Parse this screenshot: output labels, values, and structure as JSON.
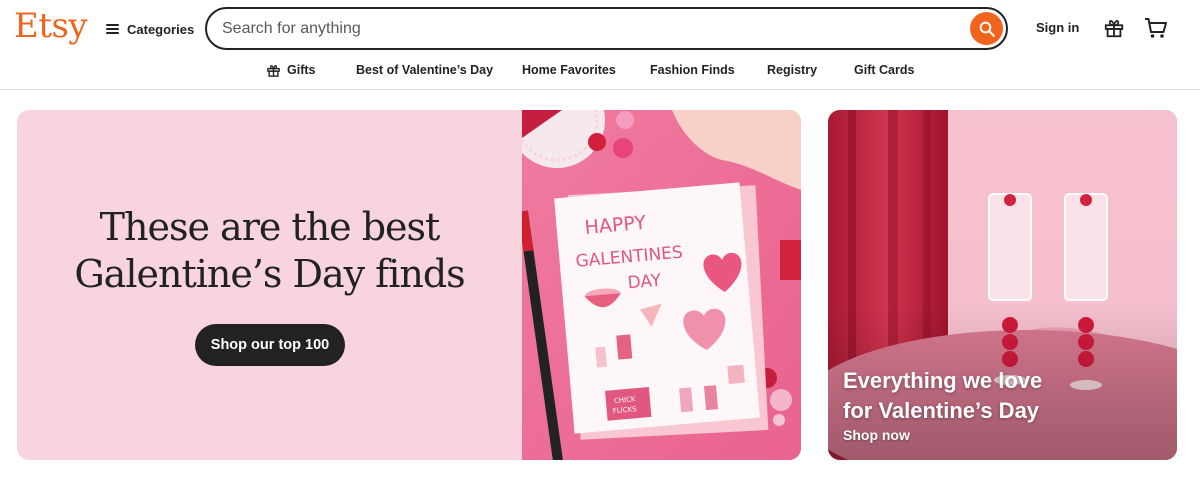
{
  "header": {
    "logo": "Etsy",
    "categories_label": "Categories",
    "search": {
      "placeholder": "Search for anything",
      "value": ""
    },
    "sign_in": "Sign in",
    "icons": {
      "search": "search-icon",
      "gift": "gift-icon",
      "cart": "cart-icon",
      "menu": "hamburger-icon"
    }
  },
  "nav": {
    "items": [
      {
        "label": "Gifts",
        "icon": "gift-icon"
      },
      {
        "label": "Best of Valentine’s Day"
      },
      {
        "label": "Home Favorites"
      },
      {
        "label": "Fashion Finds"
      },
      {
        "label": "Registry"
      },
      {
        "label": "Gift Cards"
      }
    ]
  },
  "hero": {
    "title_line1": "These are the best",
    "title_line2": "Galentine’s Day finds",
    "cta": "Shop our top 100",
    "card_text_line1": "HAPPY",
    "card_text_line2": "GALENTINES",
    "card_text_line3": "DAY",
    "card_tag_line1": "CHICK",
    "card_tag_line2": "FLICKS"
  },
  "promo": {
    "title_line1": "Everything we love",
    "title_line2": "for Valentine’s Day",
    "link": "Shop now"
  },
  "colors": {
    "brand": "#f1641e",
    "hero_bg": "#f8d4de",
    "button_dark": "#222222"
  }
}
